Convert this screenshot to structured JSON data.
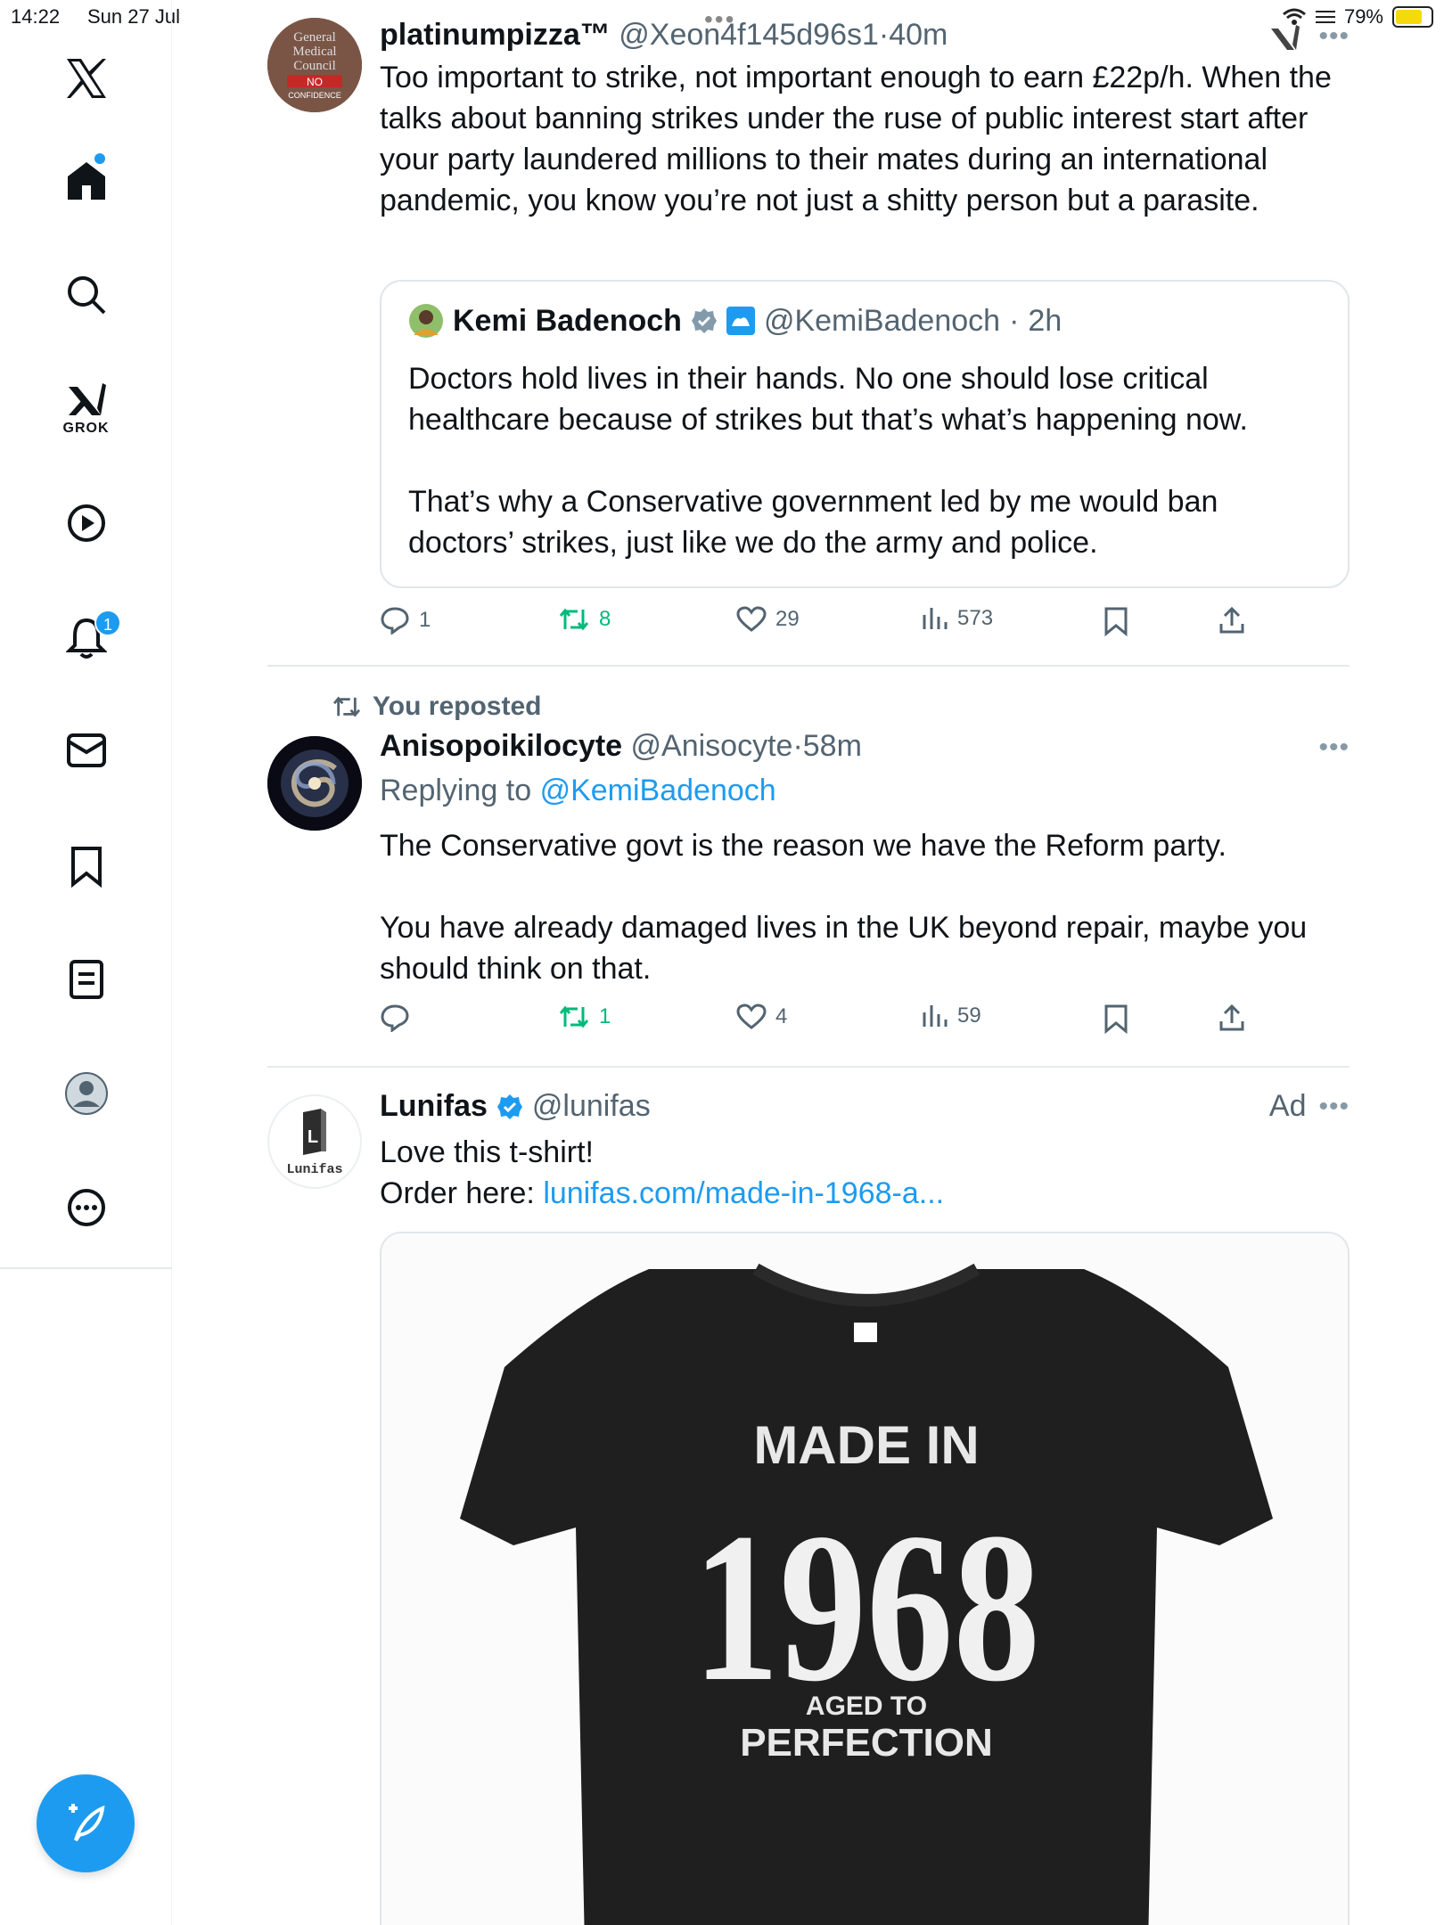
{
  "status": {
    "time": "14:22",
    "date": "Sun 27 Jul",
    "battery": "79%"
  },
  "sidebar": {
    "grok_label": "GROK",
    "notifications_badge": "1"
  },
  "posts": [
    {
      "name": "platinumpizza™",
      "handle": "@Xeon4f145d96s1",
      "time": "40m",
      "avatar_lines": [
        "General",
        "Medical",
        "Council",
        "NO",
        "CONFIDENCE"
      ],
      "text": "Too important to strike, not important enough to earn £22p/h. When the talks about banning strikes under the ruse of public interest start after your party laundered millions to their mates during an international pandemic, you know you’re not just a shitty person but a parasite.",
      "quote": {
        "name": "Kemi Badenoch",
        "handle": "@KemiBadenoch",
        "time": "2h",
        "para1": "Doctors hold lives in their hands. No one should lose critical healthcare because of strikes but that’s what’s happening now.",
        "para2": "That’s why a Conservative government led by me would ban doctors’ strikes, just like we do the army and police."
      },
      "replies": "1",
      "reposts": "8",
      "likes": "29",
      "views": "573"
    },
    {
      "repost_label": "You reposted",
      "name": "Anisopoikilocyte",
      "handle": "@Anisocyte",
      "time": "58m",
      "replying_prefix": "Replying to",
      "replying_to": "@KemiBadenoch",
      "para1": "The Conservative govt is the reason we have the Reform party.",
      "para2": "You have already damaged lives in the UK beyond repair, maybe you should think on that.",
      "reposts": "1",
      "likes": "4",
      "views": "59"
    },
    {
      "name": "Lunifas",
      "handle": "@lunifas",
      "ad_label": "Ad",
      "avatar_text": "Lunifas",
      "line1": "Love this t-shirt!",
      "order_prefix": "Order here:",
      "order_link": "lunifas.com/made-in-1968-a...",
      "shirt": {
        "line1": "MADE IN",
        "year": "1968",
        "line2": "AGED TO",
        "line3": "PERFECTION"
      }
    }
  ],
  "colors": {
    "accent": "#1d9bf0",
    "repost_green": "#00ba7c",
    "muted": "#536471"
  }
}
